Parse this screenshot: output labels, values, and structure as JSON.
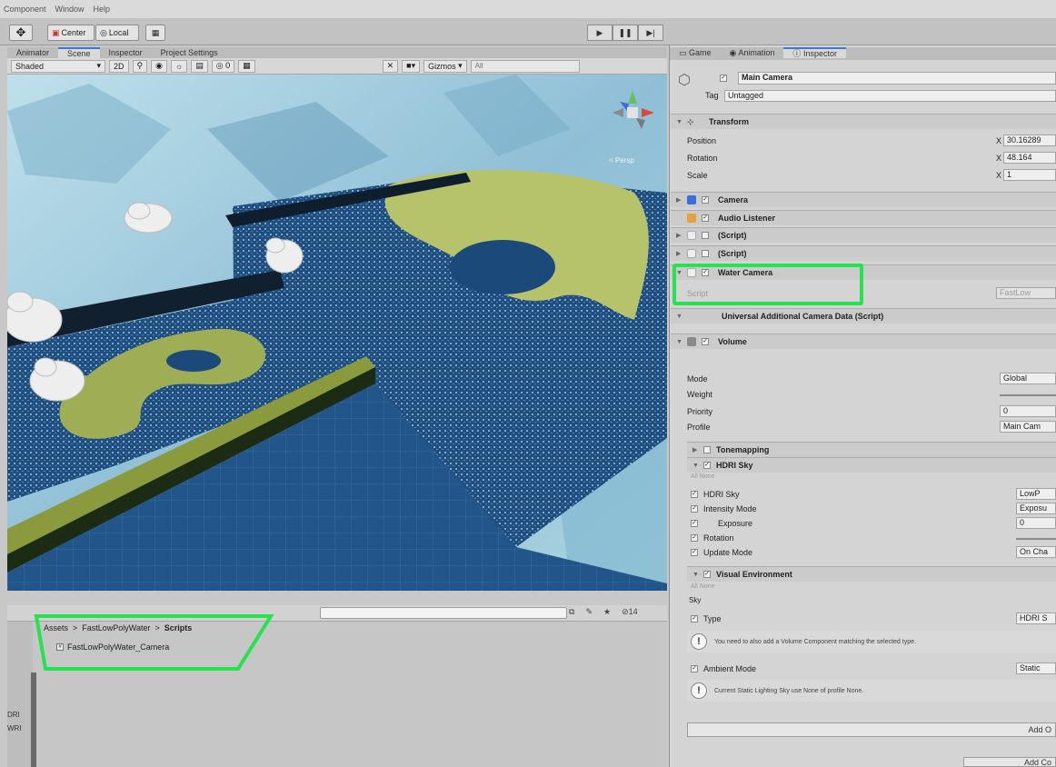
{
  "menu": {
    "items": [
      "Component",
      "Window",
      "Help"
    ]
  },
  "toolbar": {
    "hand_icon": "hand-tool-icon",
    "pivot": "Center",
    "space": "Local",
    "play": "▶",
    "pause": "❚❚",
    "step": "▶|"
  },
  "scene": {
    "tabs": [
      "Animator",
      "Scene",
      "Inspector",
      "Project Settings"
    ],
    "shading": "Shaded",
    "mode_2d": "2D",
    "gizmos": "Gizmos",
    "search_placeholder": "All",
    "persp": "< Persp",
    "tools": [
      "⚲",
      "◉",
      "☼",
      "▤",
      "◎ 0",
      "▦"
    ]
  },
  "project": {
    "breadcrumb": [
      "Assets",
      "FastLowPolyWater",
      "Scripts"
    ],
    "sep": ">",
    "file": "FastLowPolyWater_Camera",
    "count": "14",
    "side_labels": [
      "DRI",
      "WRI"
    ]
  },
  "inspector": {
    "tabs": [
      "Game",
      "Animation",
      "Inspector"
    ],
    "object_name": "Main Camera",
    "tag_label": "Tag",
    "tag_value": "Untagged",
    "transform": {
      "title": "Transform",
      "position_label": "Position",
      "position_x": "30.16289",
      "rotation_label": "Rotation",
      "rotation_x": "48.164",
      "scale_label": "Scale",
      "scale_x": "1",
      "x_label": "X"
    },
    "components": [
      "Camera",
      "Audio Listener",
      "(Script)",
      "(Script)",
      "Water Camera"
    ],
    "script_label": "Script",
    "script_value": "FastLow",
    "additional_data": "Universal Additional Camera Data (Script)",
    "volume": {
      "title": "Volume",
      "mode_label": "Mode",
      "mode_value": "Global",
      "weight_label": "Weight",
      "priority_label": "Priority",
      "priority_value": "0",
      "profile_label": "Profile",
      "profile_value": "Main Cam"
    },
    "overrides": {
      "tonemapping": "Tonemapping",
      "hdri_sky": "HDRI Sky",
      "all_none": "All  None",
      "hdri_sky_field": "HDRI Sky",
      "hdri_sky_value": "LowP",
      "intensity_mode": "Intensity Mode",
      "intensity_value": "Exposu",
      "exposure": "Exposure",
      "exposure_value": "0",
      "rotation": "Rotation",
      "update_mode": "Update Mode",
      "update_value": "On Cha",
      "visual_env": "Visual Environment",
      "sky": "Sky",
      "type": "Type",
      "type_value": "HDRI S",
      "warn1": "You need to also add a Volume Component matching the selected type.",
      "ambient": "Ambient Mode",
      "ambient_value": "Static",
      "warn2": "Current Static Lighting Sky use None of profile None."
    },
    "add_override": "Add O",
    "add_component": "Add Co"
  },
  "colors": {
    "highlight": "#27e24f",
    "water": "#1d4f7e",
    "island": "#b9c46a",
    "sky": "#9ec8d8"
  }
}
